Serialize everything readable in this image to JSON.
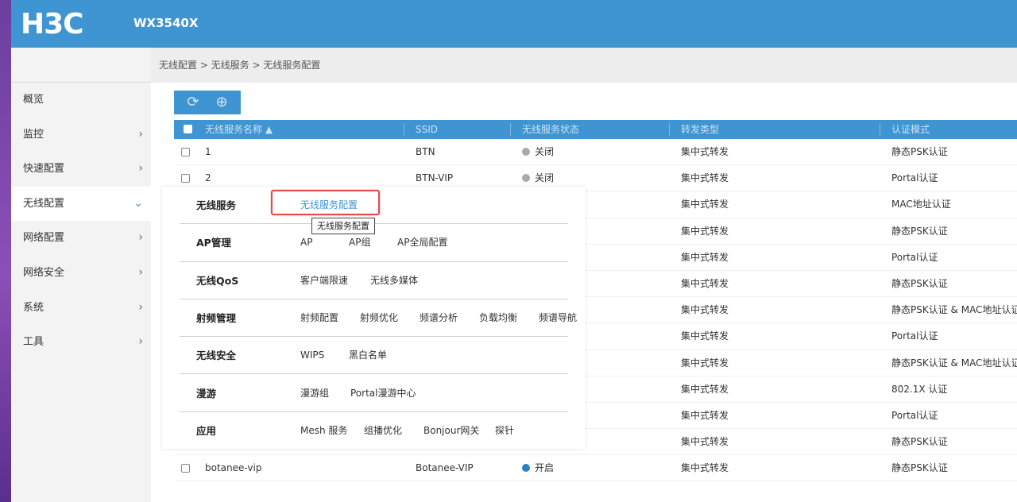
{
  "header": {
    "logo": "H3C",
    "model": "WX3540X"
  },
  "sidebar": {
    "items": [
      {
        "label": "概览",
        "has_chevron": false
      },
      {
        "label": "监控",
        "has_chevron": true
      },
      {
        "label": "快速配置",
        "has_chevron": true
      },
      {
        "label": "无线配置",
        "has_chevron": true,
        "active": true
      },
      {
        "label": "网络配置",
        "has_chevron": true
      },
      {
        "label": "网络安全",
        "has_chevron": true
      },
      {
        "label": "系统",
        "has_chevron": true
      },
      {
        "label": "工具",
        "has_chevron": true
      }
    ],
    "chevron_right": "›",
    "chevron_down": "⌄"
  },
  "breadcrumb": "无线配置 > 无线服务 > 无线服务配置",
  "toolbar": {
    "refresh_icon": "⟳",
    "add_icon": "⊕"
  },
  "table": {
    "columns": [
      "无线服务名称 ▲",
      "SSID",
      "无线服务状态",
      "转发类型",
      "认证模式"
    ],
    "rows": [
      {
        "name": "1",
        "ssid": "BTN",
        "status": "关闭",
        "forward": "集中式转发",
        "auth": "静态PSK认证"
      },
      {
        "name": "2",
        "ssid": "BTN-VIP",
        "status": "关闭",
        "forward": "集中式转发",
        "auth": "Portal认证"
      },
      {
        "name": "",
        "ssid": "",
        "status": "",
        "forward": "集中式转发",
        "auth": "MAC地址认证"
      },
      {
        "name": "",
        "ssid": "",
        "status": "",
        "forward": "集中式转发",
        "auth": "静态PSK认证"
      },
      {
        "name": "",
        "ssid": "",
        "status": "",
        "forward": "集中式转发",
        "auth": "Portal认证"
      },
      {
        "name": "",
        "ssid": "",
        "status": "",
        "forward": "集中式转发",
        "auth": "静态PSK认证"
      },
      {
        "name": "",
        "ssid": "",
        "status": "",
        "forward": "集中式转发",
        "auth": "静态PSK认证 & MAC地址认证"
      },
      {
        "name": "",
        "ssid": "",
        "status": "",
        "forward": "集中式转发",
        "auth": "Portal认证"
      },
      {
        "name": "",
        "ssid": "",
        "status": "",
        "forward": "集中式转发",
        "auth": "静态PSK认证 & MAC地址认证"
      },
      {
        "name": "",
        "ssid": "",
        "status": "",
        "forward": "集中式转发",
        "auth": "802.1X 认证"
      },
      {
        "name": "",
        "ssid": "",
        "status": "",
        "forward": "集中式转发",
        "auth": "Portal认证"
      },
      {
        "name": "",
        "ssid": "",
        "status": "",
        "forward": "集中式转发",
        "auth": "静态PSK认证"
      },
      {
        "name": "botanee-vip",
        "ssid": "Botanee-VIP",
        "status": "开启",
        "forward": "集中式转发",
        "auth": "静态PSK认证"
      }
    ]
  },
  "mega_menu": {
    "groups": [
      {
        "title": "无线服务",
        "links": [
          "无线服务配置"
        ]
      },
      {
        "title": "AP管理",
        "links": [
          "AP",
          "AP组",
          "AP全局配置"
        ]
      },
      {
        "title": "无线QoS",
        "links": [
          "客户端限速",
          "无线多媒体"
        ]
      },
      {
        "title": "射频管理",
        "links": [
          "射频配置",
          "射频优化",
          "频谱分析",
          "负载均衡",
          "频谱导航"
        ]
      },
      {
        "title": "无线安全",
        "links": [
          "WIPS",
          "黑白名单"
        ]
      },
      {
        "title": "漫游",
        "links": [
          "漫游组",
          "Portal漫游中心"
        ]
      },
      {
        "title": "应用",
        "links": [
          "Mesh 服务",
          "组播优化",
          "Bonjour网关",
          "探针"
        ]
      }
    ],
    "tooltip": "无线服务配置"
  },
  "colors": {
    "brand_blue": "#3f95d1",
    "highlight_red": "#e14b4b"
  }
}
